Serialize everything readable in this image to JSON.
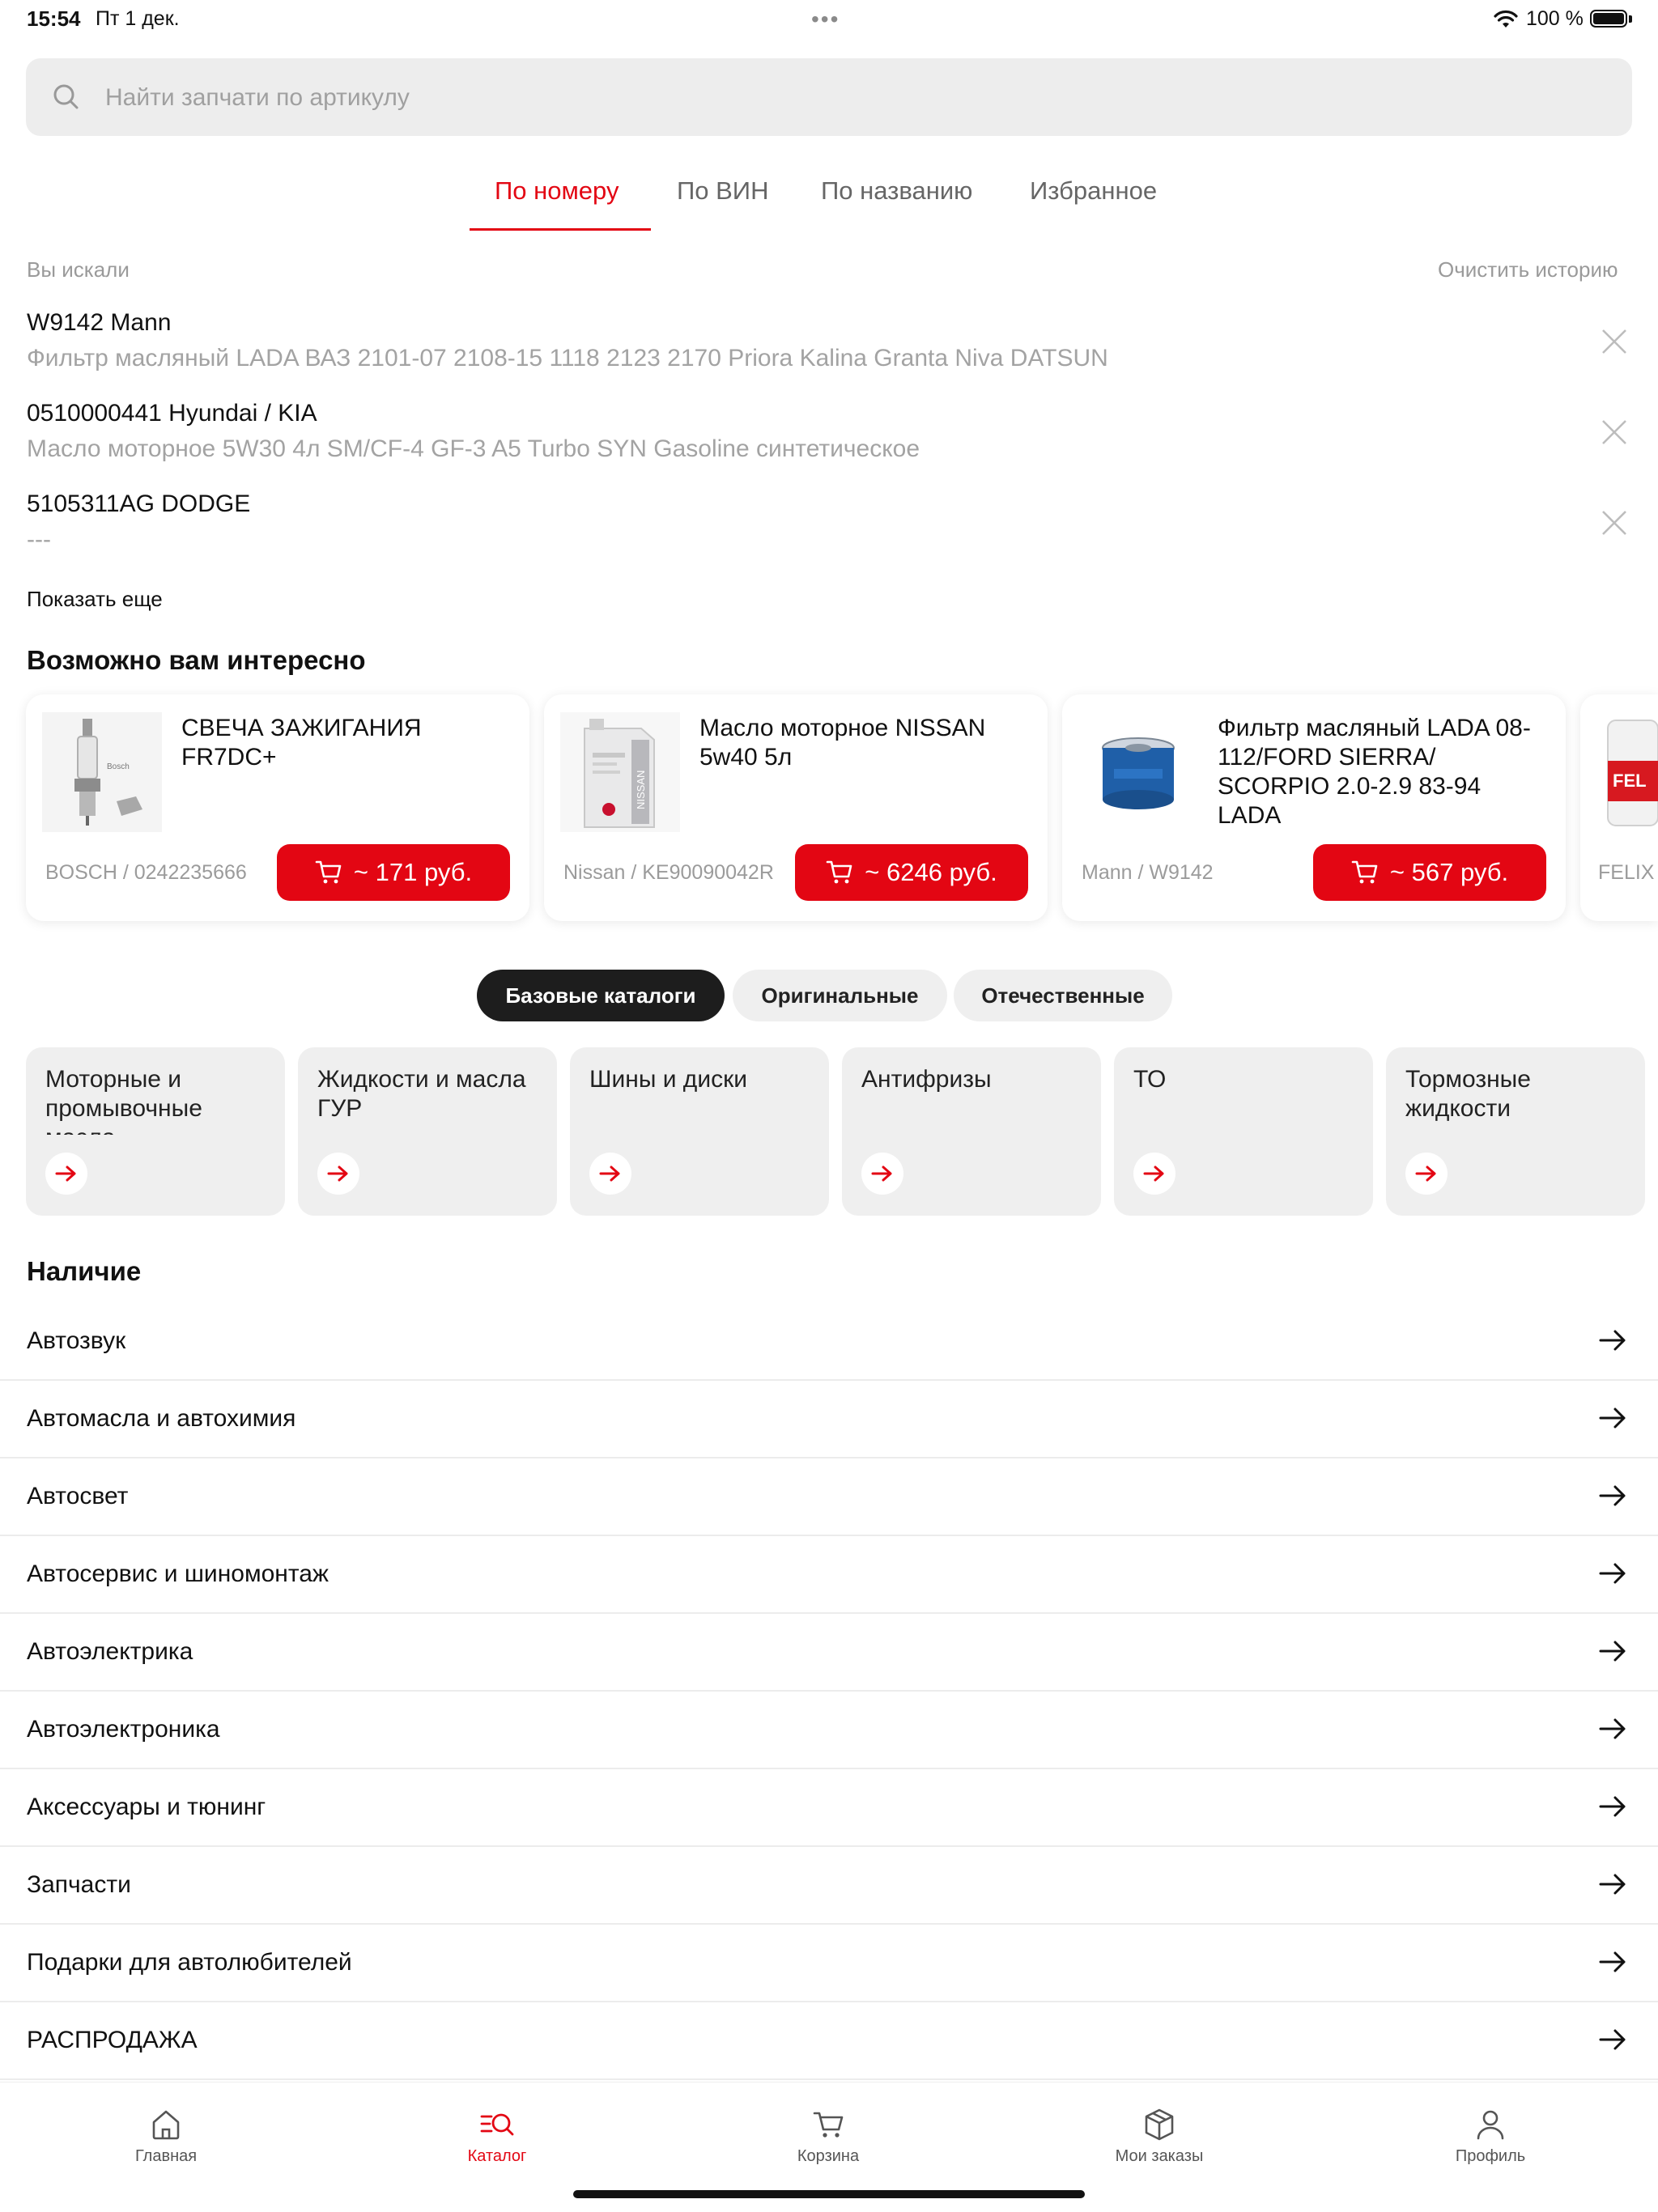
{
  "status": {
    "time": "15:54",
    "date": "Пт 1 дек.",
    "battery": "100 %"
  },
  "search": {
    "placeholder": "Найти запчати по артикулу"
  },
  "tabs": [
    "По номеру",
    "По ВИН",
    "По названию",
    "Избранное"
  ],
  "history": {
    "label": "Вы искали",
    "clear_label": "Очистить историю",
    "items": [
      {
        "title": "W9142 Mann",
        "subtitle": "Фильтр масляный LADA ВАЗ 2101-07 2108-15 1118 2123 2170 Priora Kalina Granta Niva DATSUN"
      },
      {
        "title": "0510000441 Hyundai / KIA",
        "subtitle": "Масло моторное 5W30 4л SM/CF-4 GF-3 A5 Turbo SYN Gasoline синтетическое"
      },
      {
        "title": "5105311AG DODGE",
        "subtitle": "---"
      }
    ],
    "show_more": "Показать еще"
  },
  "recommend": {
    "title": "Возможно вам интересно",
    "products": [
      {
        "name": "СВЕЧА ЗАЖИГАНИЯ FR7DC+",
        "code": "BOSCH / 0242235666",
        "price": "~ 171 руб.",
        "image": "spark-plug"
      },
      {
        "name": "Масло моторное NISSAN 5w40 5л",
        "code": "Nissan / KE90090042R",
        "price": "~ 6246 руб.",
        "image": "oil-canister"
      },
      {
        "name": "Фильтр масляный LADA 08-112/FORD SIERRA/ SCORPIO 2.0-2.9 83-94 LADA",
        "code": "Mann / W9142",
        "price": "~ 567 руб.",
        "image": "oil-filter"
      },
      {
        "name": "",
        "code": "FELIX",
        "price": "",
        "image": "fluid-bottle"
      }
    ]
  },
  "catalog_pills": [
    "Базовые каталоги",
    "Оригинальные",
    "Отечественные"
  ],
  "catalog_tiles": [
    "Моторные и промывочные масла",
    "Жидкости и масла ГУР",
    "Шины и диски",
    "Антифризы",
    "ТО",
    "Тормозные жидкости"
  ],
  "availability": {
    "title": "Наличие",
    "items": [
      "Автозвук",
      "Автомасла и автохимия",
      "Автосвет",
      "Автосервис и шиномонтаж",
      "Автоэлектрика",
      "Автоэлектроника",
      "Аксессуары и тюнинг",
      "Запчасти",
      "Подарки для автолюбителей",
      "РАСПРОДАЖА"
    ]
  },
  "nav": [
    "Главная",
    "Каталог",
    "Корзина",
    "Мои заказы",
    "Профиль"
  ],
  "colors": {
    "accent": "#e30613",
    "pill_active": "#1d1d1d",
    "tile_bg": "#efefef",
    "search_bg": "#ededed"
  }
}
